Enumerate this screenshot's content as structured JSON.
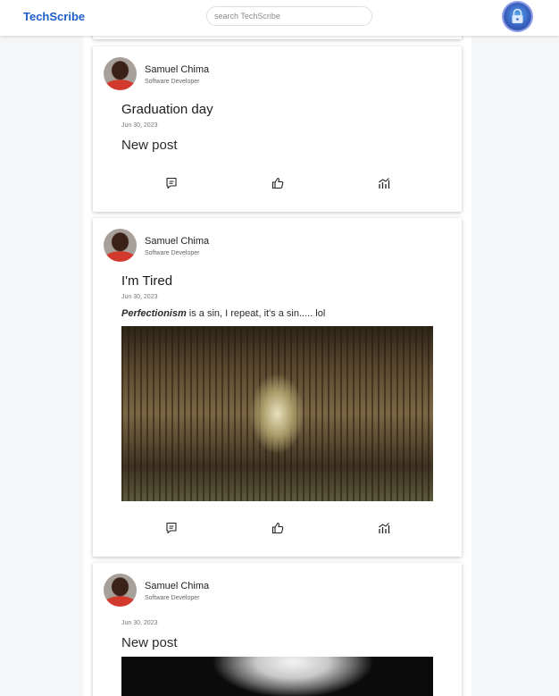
{
  "header": {
    "brand": "TechScribe",
    "search_placeholder": "search TechScribe"
  },
  "posts": [
    {
      "author": "Samuel Chima",
      "role": "Software Developer",
      "title": "Graduation day",
      "date": "Jun 30, 2023",
      "body": "New post"
    },
    {
      "author": "Samuel Chima",
      "role": "Software Developer",
      "title": "I'm Tired",
      "date": "Jun 30, 2023",
      "body_emphasis": "Perfectionism",
      "body_rest": " is a sin, I repeat, it's a sin..... lol"
    },
    {
      "author": "Samuel Chima",
      "role": "Software Developer",
      "date": "Jun 30, 2023",
      "body": "New post"
    }
  ],
  "icons": {
    "comment": "comment-icon",
    "like": "thumbs-up-icon",
    "stats": "analytics-icon",
    "profile": "lock-icon"
  },
  "colors": {
    "brand": "#1f5fc9",
    "avatar_ring": "#8c9be8"
  }
}
